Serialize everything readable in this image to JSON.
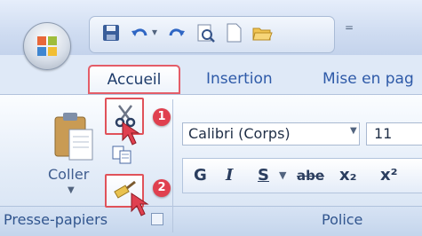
{
  "tabs": [
    {
      "label": "Accueil",
      "active": true
    },
    {
      "label": "Insertion",
      "active": false
    },
    {
      "label": "Mise en pag",
      "active": false
    }
  ],
  "quick_access": {
    "icons": [
      "save-icon",
      "undo-icon",
      "redo-icon",
      "print-preview-icon",
      "new-document-icon",
      "open-folder-icon"
    ],
    "customize_glyph": "="
  },
  "clipboard_group": {
    "paste_label": "Coller",
    "label": "Presse-papiers",
    "cut_icon": "scissors-icon",
    "copy_icon": "copy-icon",
    "format_painter_icon": "paintbrush-icon"
  },
  "font_group": {
    "label": "Police",
    "font_name": "Calibri (Corps)",
    "font_size": "11",
    "format_buttons": [
      "G",
      "I",
      "S",
      "abe",
      "x₂",
      "x²"
    ]
  },
  "callouts": [
    {
      "number": "1",
      "target": "cut-button"
    },
    {
      "number": "2",
      "target": "format-painter-button"
    }
  ],
  "colors": {
    "highlight": "#e0525a",
    "badge": "#e0404f",
    "tab_text": "#2e5aa8"
  }
}
